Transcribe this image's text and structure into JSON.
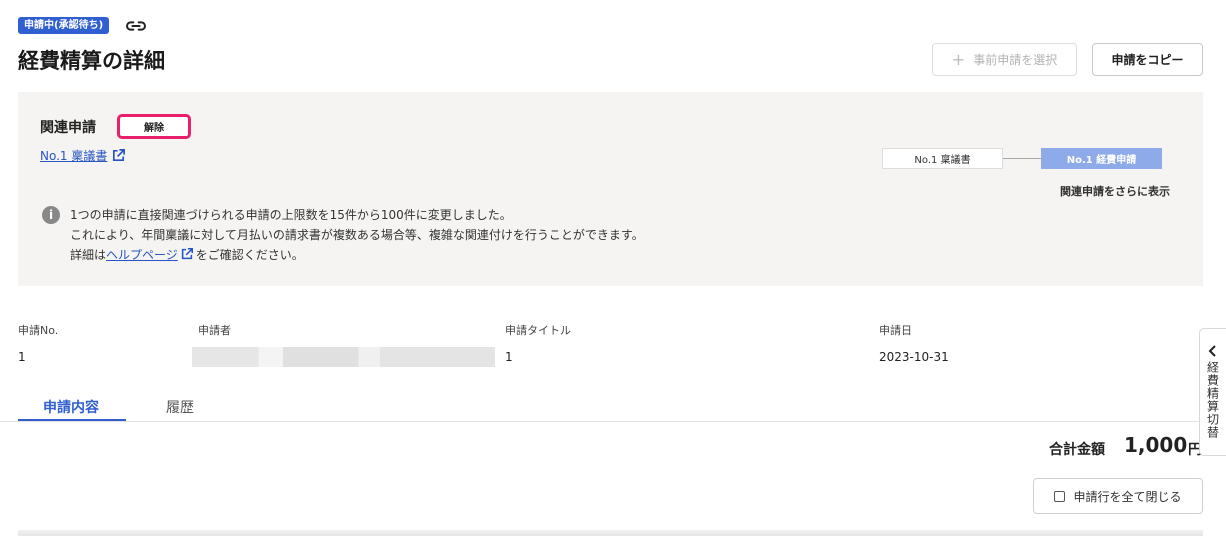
{
  "header": {
    "status_badge": "申請中(承認待ち)",
    "title": "経費精算の詳細",
    "preselect_button": "事前申請を選択",
    "copy_button": "申請をコピー"
  },
  "related": {
    "title": "関連申請",
    "unlink_button": "解除",
    "link_text": "No.1 稟議書",
    "flow": [
      "No.1 稟議書",
      "No.1 経費申請"
    ],
    "show_more": "関連申請をさらに表示",
    "info_line1": "1つの申請に直接関連づけられる申請の上限数を15件から100件に変更しました。",
    "info_line2": "これにより、年間稟議に対して月払いの請求書が複数ある場合等、複雑な関連付けを行うことができます。",
    "info_line3_prefix": "詳細は",
    "info_help_link": "ヘルプページ",
    "info_line3_suffix": "をご確認ください。"
  },
  "meta": {
    "labels": [
      "申請No.",
      "申請者",
      "申請タイトル",
      "申請日"
    ],
    "no": "1",
    "title": "1",
    "date": "2023-10-31"
  },
  "tabs": [
    "申請内容",
    "履歴"
  ],
  "total": {
    "label": "合計金額",
    "value": "1,000",
    "unit": "円"
  },
  "collapse_button": "申請行を全て閉じる",
  "side_tab": "経費精算切替",
  "colors": {
    "accent": "#2f5fd0",
    "highlight": "#e8206b",
    "flow_active": "#8faae8",
    "link": "#2855c4"
  }
}
